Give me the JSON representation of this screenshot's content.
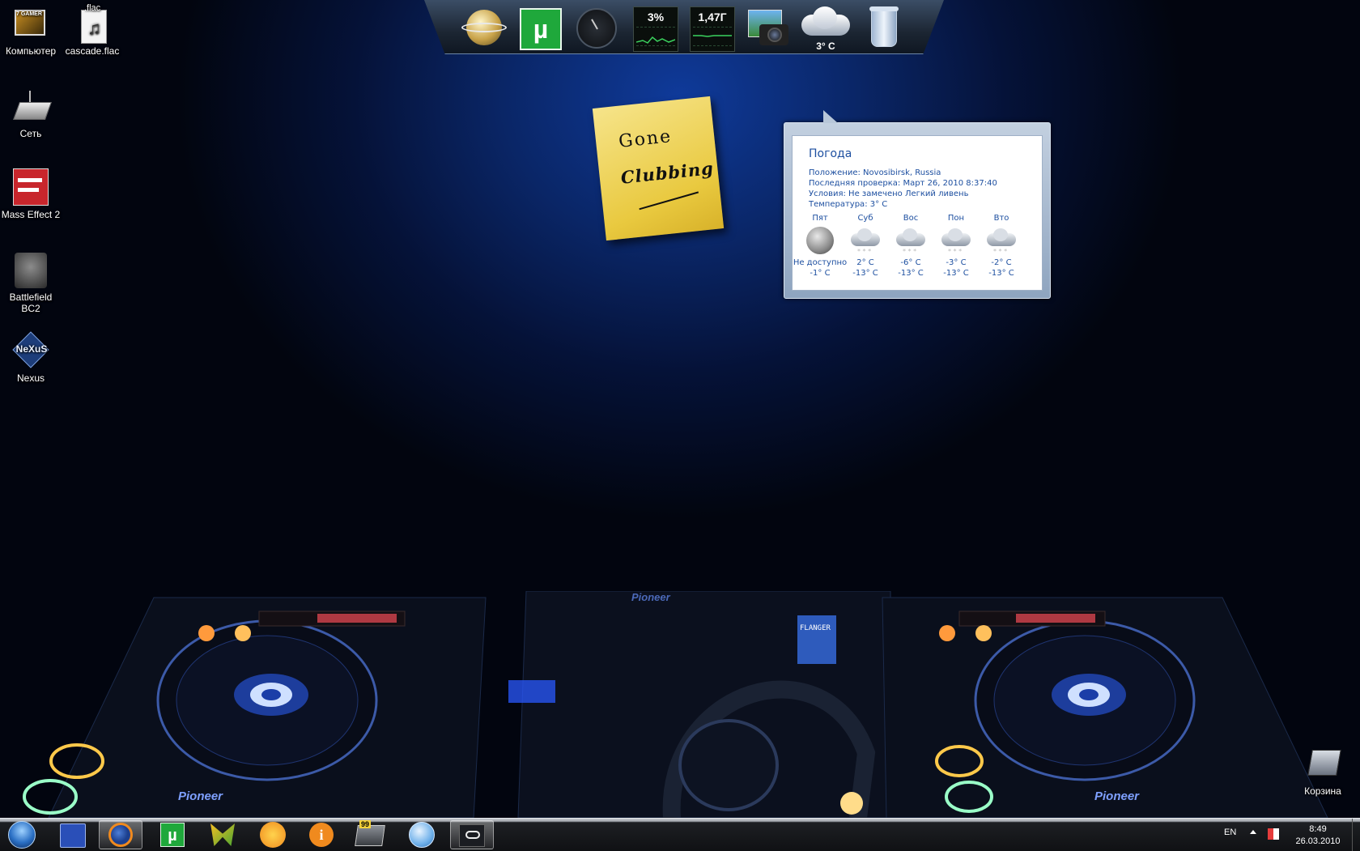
{
  "desktop": {
    "icons": [
      {
        "label": "Компьютер",
        "badge": "7 GAMER"
      },
      {
        "label": "cascade.flac",
        "badge": ".flac"
      },
      {
        "label": "Сеть"
      },
      {
        "label": "Mass Effect 2"
      },
      {
        "label": "Battlefield BC2"
      },
      {
        "label": "Nexus"
      },
      {
        "label": "Корзина"
      }
    ]
  },
  "dock": {
    "cpu": "3%",
    "memory": "1,47Г",
    "weather_temp": "3° C",
    "icons": [
      "globe-icon",
      "utorrent-icon",
      "clock-gadget-icon",
      "cpu-meter-icon",
      "memory-meter-icon",
      "photo-camera-icon",
      "weather-cloud-icon",
      "recycle-bin-icon"
    ]
  },
  "sticky": {
    "line1": "Gone",
    "line2": "Clubbing"
  },
  "weather": {
    "title": "Погода",
    "location": "Положение: Novosibirsk, Russia",
    "last_check": "Последняя проверка: Март 26, 2010 8:37:40",
    "conditions": "Условия: Не замечено Легкий ливень",
    "temperature": "Температура: 3° C",
    "days": [
      {
        "name": "Пят",
        "hi": "Не доступно",
        "lo": "-1° C",
        "icon": "moon-icon"
      },
      {
        "name": "Суб",
        "hi": "2° C",
        "lo": "-13° C",
        "icon": "snow-cloud-icon"
      },
      {
        "name": "Вос",
        "hi": "-6° C",
        "lo": "-13° C",
        "icon": "snow-cloud-icon"
      },
      {
        "name": "Пон",
        "hi": "-3° C",
        "lo": "-13° C",
        "icon": "snow-cloud-icon"
      },
      {
        "name": "Вто",
        "hi": "-2° C",
        "lo": "-13° C",
        "icon": "snow-cloud-icon"
      }
    ]
  },
  "taskbar": {
    "start": "start-orb-icon",
    "items": [
      "save-disk-icon",
      "firefox-icon",
      "utorrent-icon",
      "butterfly-icon",
      "aimp-icon",
      "info-icon",
      "monitor-99-icon",
      "itunes-icon",
      "steam-icon"
    ],
    "monitor_badge": "99",
    "language": "EN",
    "time": "8:49",
    "date": "26.03.2010"
  },
  "wallpaper": {
    "brand_left": "Pioneer",
    "brand_right": "Pioneer",
    "mixer_brand": "Pioneer",
    "mixer_display": "FLANGER"
  }
}
